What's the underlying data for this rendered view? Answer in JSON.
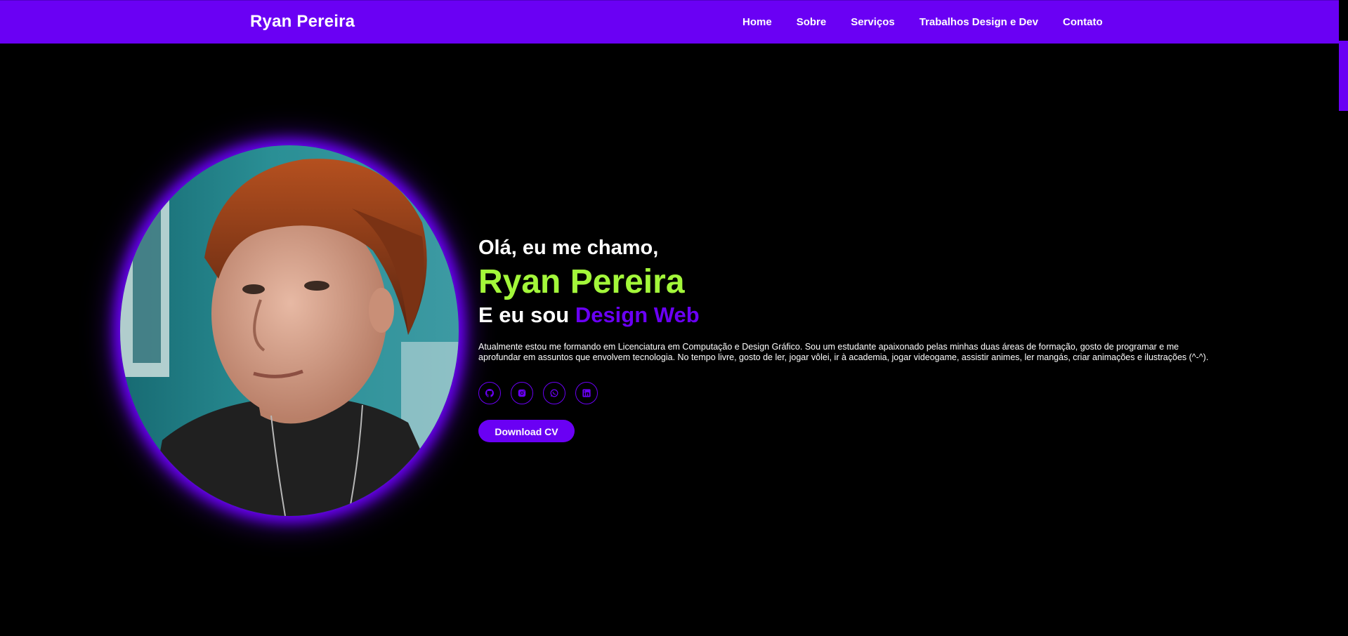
{
  "header": {
    "brand": "Ryan Pereira",
    "nav": [
      {
        "label": "Home"
      },
      {
        "label": "Sobre"
      },
      {
        "label": "Serviços"
      },
      {
        "label": "Trabalhos Design e Dev"
      },
      {
        "label": "Contato"
      }
    ]
  },
  "hero": {
    "greeting": "Olá, eu me chamo,",
    "name": "Ryan Pereira",
    "role_prefix": "E eu sou ",
    "role_highlight": "Design Web",
    "about": "Atualmente estou me formando em Licenciatura em Computação e Design Gráfico. Sou um estudante apaixonado pelas minhas duas áreas de formação, gosto de programar e me aprofundar em assuntos que envolvem tecnologia. No tempo livre, gosto de ler, jogar vôlei, ir à academia, jogar videogame, assistir animes, ler mangás, criar animações e ilustrações (^-^).",
    "socials": [
      {
        "icon": "github-icon"
      },
      {
        "icon": "instagram-icon"
      },
      {
        "icon": "whatsapp-icon"
      },
      {
        "icon": "linkedin-icon"
      }
    ],
    "cv_button": "Download CV"
  },
  "colors": {
    "accent": "#6a00f4",
    "name_green": "#a3f73a",
    "background": "#000000"
  }
}
